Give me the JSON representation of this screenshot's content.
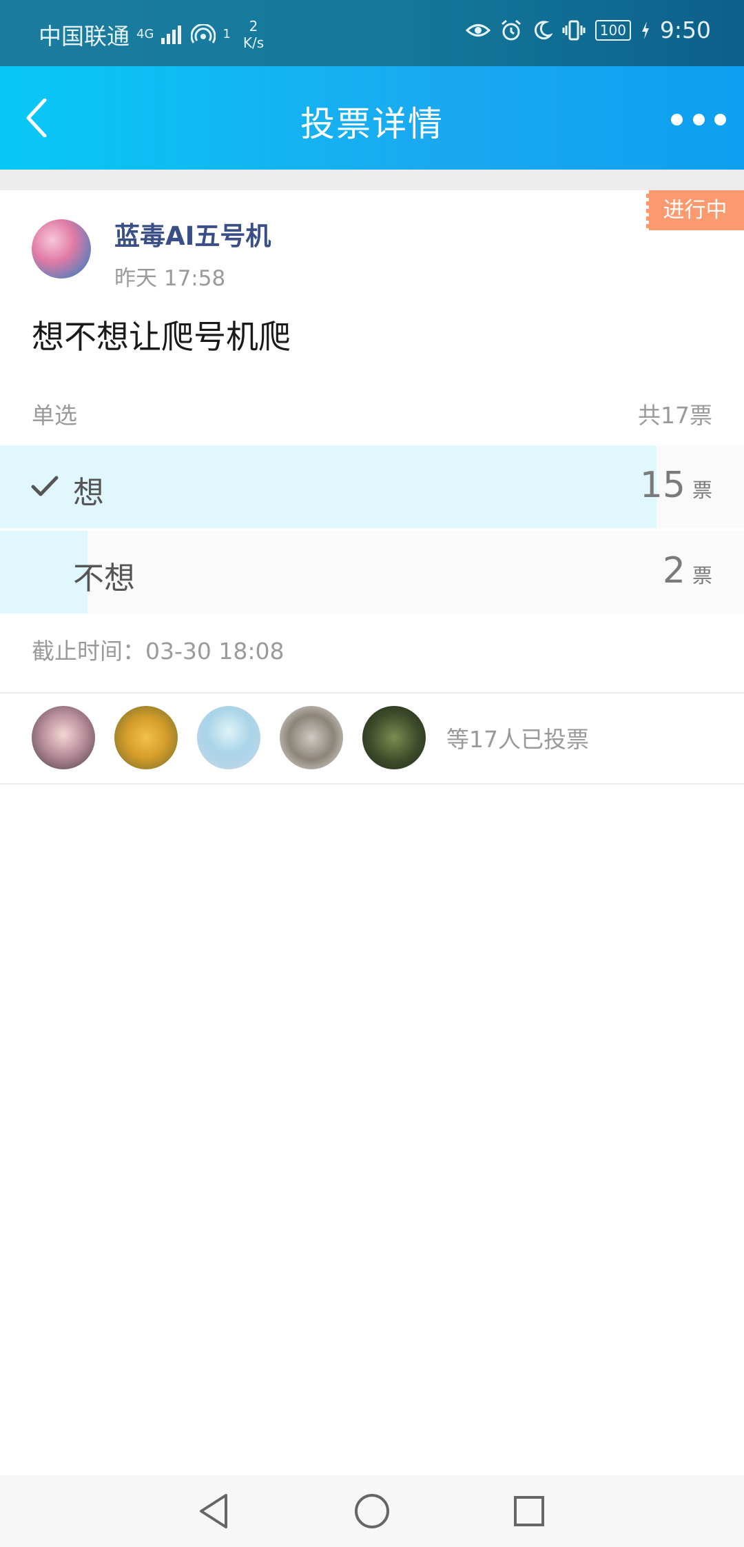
{
  "status_bar": {
    "carrier": "中国联通",
    "network_type": "4G",
    "sim_index": "1",
    "speed_value": "2",
    "speed_unit": "K/s",
    "battery": "100",
    "time": "9:50"
  },
  "header": {
    "title": "投票详情",
    "back_icon": "chevron-left-icon",
    "more_icon": "more-dots-icon"
  },
  "poll": {
    "status_badge": "进行中",
    "author": "蓝毒AI五号机",
    "posted_time": "昨天 17:58",
    "question": "想不想让爬号机爬",
    "vote_type": "单选",
    "total_votes": "共17票",
    "options": [
      {
        "label": "想",
        "count": "15",
        "unit": "票",
        "selected": true,
        "fraction": 0.882
      },
      {
        "label": "不想",
        "count": "2",
        "unit": "票",
        "selected": false,
        "fraction": 0.118
      }
    ],
    "deadline": "截止时间：03-30 18:08",
    "voters_text": "等17人已投票"
  },
  "colors": {
    "header_gradient_start": "#08c8f7",
    "header_gradient_end": "#0e9ff0",
    "badge": "#fa9a6e",
    "option_fill": "#e0f7fe",
    "author_name": "#3a4f86"
  }
}
